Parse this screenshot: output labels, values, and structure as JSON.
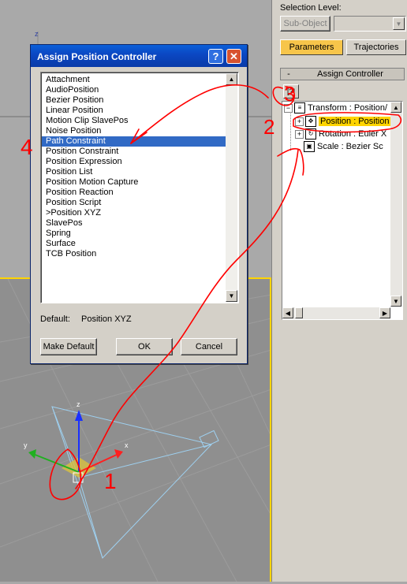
{
  "panel": {
    "selection_level_label": "Selection Level:",
    "sub_object_button": "Sub-Object",
    "tabs": {
      "parameters": "Parameters",
      "trajectories": "Trajectories"
    },
    "rollout_title": "Assign Controller",
    "rollout_toggle": "-",
    "tree": [
      {
        "label": "Transform : Position/"
      },
      {
        "label": "Position : Position"
      },
      {
        "label": "Rotation : Euler X"
      },
      {
        "label": "Scale : Bezier Sc"
      }
    ]
  },
  "dialog": {
    "title": "Assign Position Controller",
    "items": [
      "Attachment",
      "AudioPosition",
      "Bezier Position",
      "Linear Position",
      "Motion Clip SlavePos",
      "Noise Position",
      "Path Constraint",
      "Position Constraint",
      "Position Expression",
      "Position List",
      "Position Motion Capture",
      "Position Reaction",
      "Position Script",
      ">Position XYZ",
      "SlavePos",
      "Spring",
      "Surface",
      "TCB Position"
    ],
    "selected_item": "Path Constraint",
    "default_label": "Default:",
    "default_value": "Position XYZ",
    "buttons": {
      "make_default": "Make Default",
      "ok": "OK",
      "cancel": "Cancel"
    }
  },
  "annotations": [
    "1",
    "2",
    "3",
    "4"
  ],
  "colors": {
    "highlight": "#316ac5",
    "viewport_border": "#ffd400",
    "tab_active": "#f7c54a",
    "annotation": "#ff0000"
  }
}
